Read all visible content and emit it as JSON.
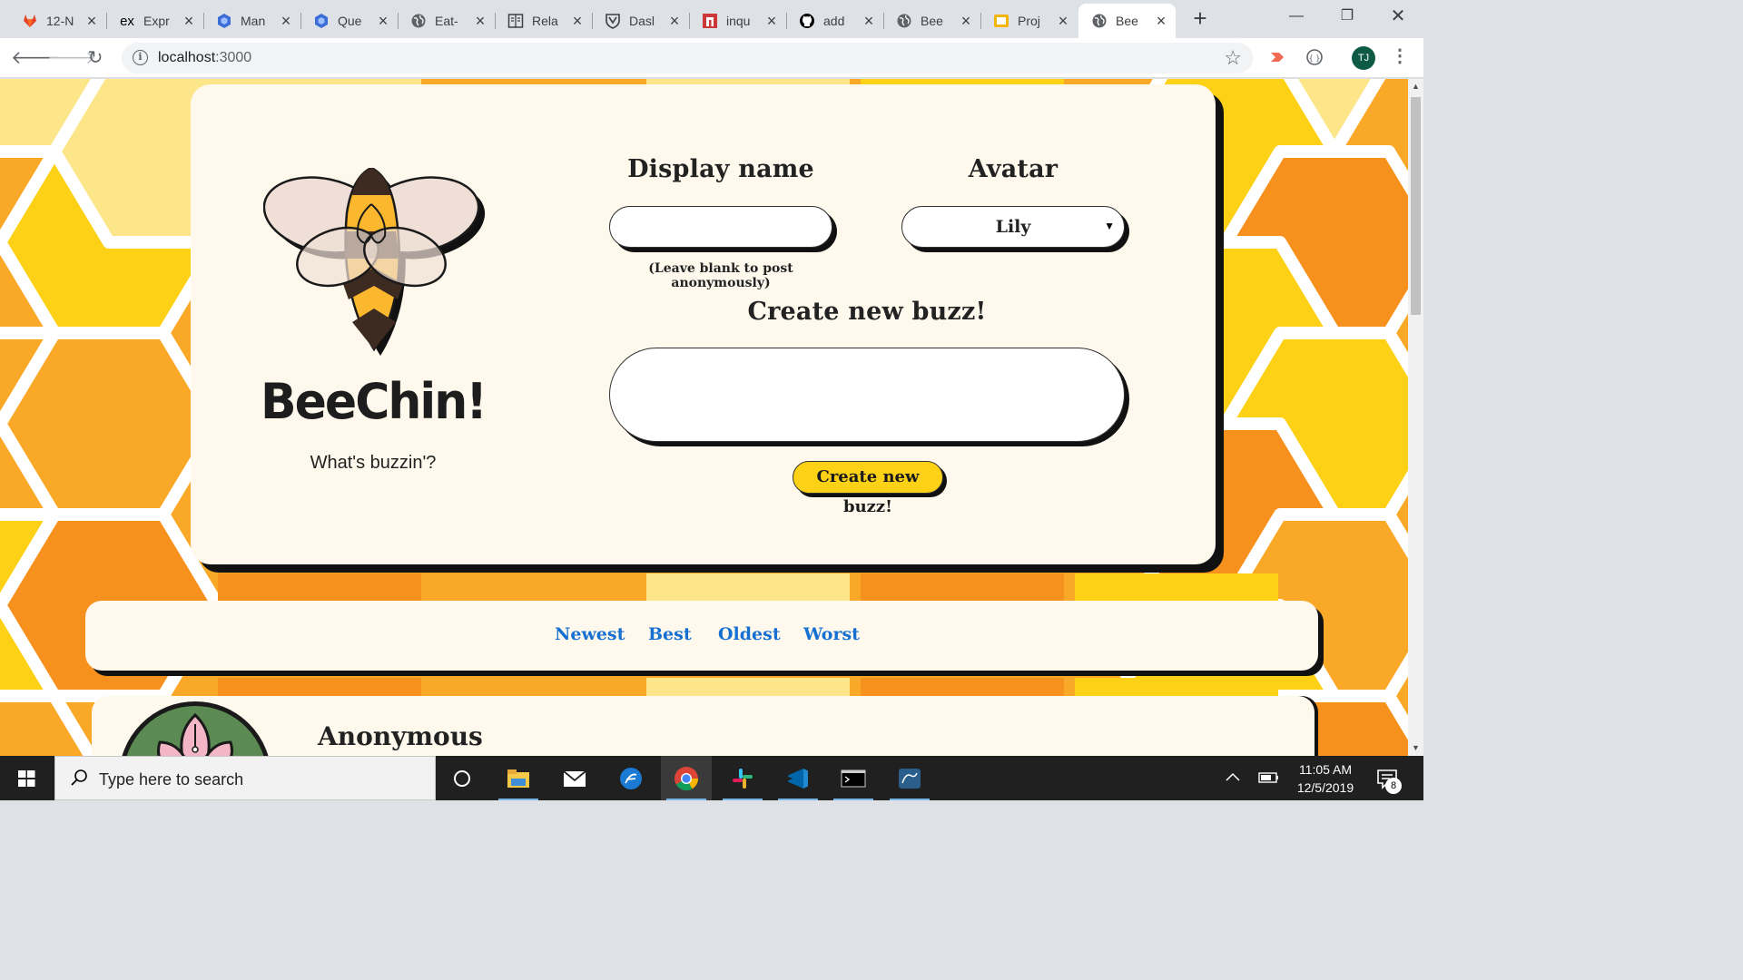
{
  "browser": {
    "tabs": [
      {
        "title": "12-N",
        "icon": "gitlab-icon",
        "color": "#e24329"
      },
      {
        "title": "Expr",
        "icon": "express-icon",
        "color": "#000000"
      },
      {
        "title": "Man",
        "icon": "cube-icon",
        "color": "#3b6dd6"
      },
      {
        "title": "Que",
        "icon": "cube-icon",
        "color": "#3b6dd6"
      },
      {
        "title": "Eat-",
        "icon": "globe-icon",
        "color": "#5f6368"
      },
      {
        "title": "Rela",
        "icon": "book-icon",
        "color": "#3c4043"
      },
      {
        "title": "Dasl",
        "icon": "shield-icon",
        "color": "#3c4043"
      },
      {
        "title": "inqu",
        "icon": "npm-icon",
        "color": "#cb3837"
      },
      {
        "title": "add",
        "icon": "github-icon",
        "color": "#000000"
      },
      {
        "title": "Bee",
        "icon": "globe-icon",
        "color": "#5f6368"
      },
      {
        "title": "Proj",
        "icon": "slides-icon",
        "color": "#f4b400"
      },
      {
        "title": "Bee",
        "icon": "globe-icon",
        "color": "#5f6368",
        "active": true
      }
    ],
    "url_host": "localhost",
    "url_port": ":3000",
    "profile_initials": "TJ"
  },
  "app": {
    "brand": "BeeChin!",
    "tagline": "What's buzzin'?",
    "display_name_label": "Display name",
    "display_name_value": "",
    "display_name_hint": "(Leave blank to post anonymously)",
    "avatar_label": "Avatar",
    "avatar_value": "Lily",
    "create_label": "Create new buzz!",
    "buzz_value": "",
    "create_button": "Create new buzz!",
    "sort_options": [
      "Newest",
      "Best",
      "Oldest",
      "Worst"
    ],
    "post_author": "Anonymous"
  },
  "taskbar": {
    "search_placeholder": "Type here to search",
    "time": "11:05 AM",
    "date": "12/5/2019",
    "notification_count": "8"
  },
  "colors": {
    "honey": "#fcd116",
    "card": "#fef9ec",
    "link": "#1670d2"
  }
}
